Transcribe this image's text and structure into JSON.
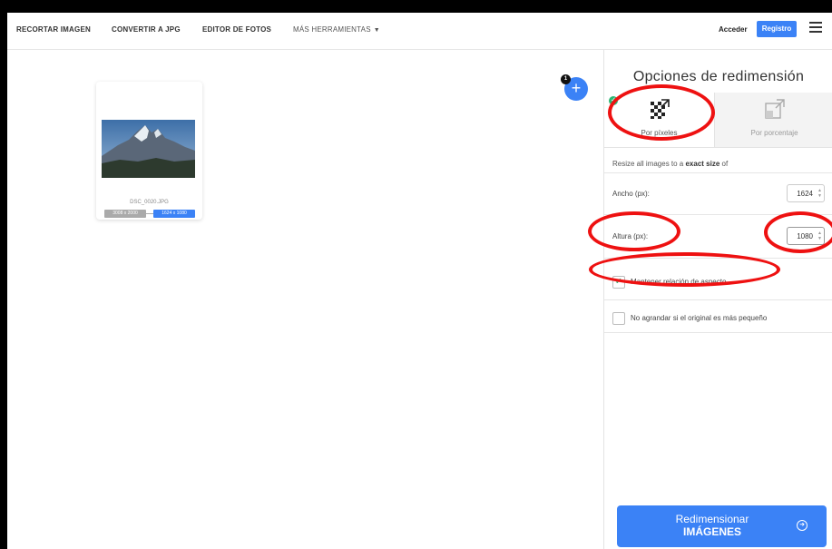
{
  "nav": {
    "crop": "RECORTAR IMAGEN",
    "convert": "CONVERTIR A JPG",
    "editor": "EDITOR DE FOTOS",
    "more": "MÁS HERRAMIENTAS",
    "login": "Acceder",
    "register": "Registro"
  },
  "workspace": {
    "file_count": "1",
    "image": {
      "file_name": "DSC_0020.JPG",
      "original_size": "3008 x 2000",
      "new_size": "1624 x 1080"
    }
  },
  "sidebar": {
    "title": "Opciones de redimensión",
    "tabs": {
      "pixel": "Por píxeles",
      "percent": "Por porcentaje"
    },
    "desc_pre": "Resize all images to a ",
    "desc_bold": "exact size",
    "desc_post": " of",
    "width_label": "Ancho (px):",
    "width_value": "1624",
    "height_label": "Altura (px):",
    "height_value": "1080",
    "keep_aspect": "Mantener relación de aspecto",
    "keep_aspect_checked": true,
    "no_enlarge": "No agrandar si el original es más pequeño",
    "no_enlarge_checked": false,
    "resize_line1": "Redimensionar",
    "resize_line2": "IMÁGENES"
  },
  "colors": {
    "accent": "#3b82f6",
    "annotation": "#ee1111",
    "check": "#2bb673"
  }
}
